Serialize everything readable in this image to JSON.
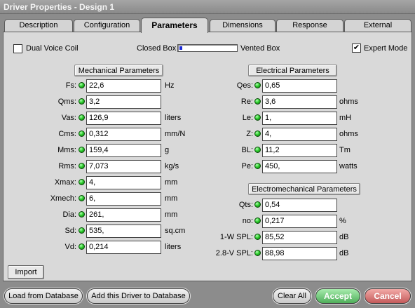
{
  "window": {
    "title": "Driver Properties - Design 1"
  },
  "tabs": [
    "Description",
    "Configuration",
    "Parameters",
    "Dimensions",
    "Response",
    "External"
  ],
  "active_tab": "Parameters",
  "options": {
    "dual_voice_coil_label": "Dual Voice Coil",
    "dual_voice_coil_checked": false,
    "closed_box_label": "Closed Box",
    "vented_box_label": "Vented Box",
    "box_slider_value": 0,
    "expert_mode_label": "Expert Mode",
    "expert_mode_checked": true,
    "check_glyph": "✔"
  },
  "mechanical": {
    "header": "Mechanical Parameters",
    "params": [
      {
        "label": "Fs:",
        "value": "22,6",
        "unit": "Hz"
      },
      {
        "label": "Qms:",
        "value": "3,2",
        "unit": ""
      },
      {
        "label": "Vas:",
        "value": "126,9",
        "unit": "liters"
      },
      {
        "label": "Cms:",
        "value": "0,312",
        "unit": "mm/N"
      },
      {
        "label": "Mms:",
        "value": "159,4",
        "unit": "g"
      },
      {
        "label": "Rms:",
        "value": "7,073",
        "unit": "kg/s"
      },
      {
        "label": "Xmax:",
        "value": "4,",
        "unit": "mm"
      },
      {
        "label": "Xmech:",
        "value": "6,",
        "unit": "mm"
      },
      {
        "label": "Dia:",
        "value": "261,",
        "unit": "mm"
      },
      {
        "label": "Sd:",
        "value": "535,",
        "unit": "sq.cm"
      },
      {
        "label": "Vd:",
        "value": "0,214",
        "unit": "liters"
      }
    ]
  },
  "electrical": {
    "header": "Electrical Parameters",
    "params": [
      {
        "label": "Qes:",
        "value": "0,65",
        "unit": ""
      },
      {
        "label": "Re:",
        "value": "3,6",
        "unit": "ohms"
      },
      {
        "label": "Le:",
        "value": "1,",
        "unit": "mH"
      },
      {
        "label": "Z:",
        "value": "4,",
        "unit": "ohms"
      },
      {
        "label": "BL:",
        "value": "11,2",
        "unit": "Tm"
      },
      {
        "label": "Pe:",
        "value": "450,",
        "unit": "watts"
      }
    ]
  },
  "electromechanical": {
    "header": "Electromechanical Parameters",
    "params": [
      {
        "label": "Qts:",
        "value": "0,54",
        "unit": ""
      },
      {
        "label": "no:",
        "value": "0,217",
        "unit": "%"
      },
      {
        "label": "1-W SPL:",
        "value": "85,52",
        "unit": "dB"
      },
      {
        "label": "2.8-V SPL:",
        "value": "88,98",
        "unit": "dB"
      }
    ]
  },
  "import_label": "Import",
  "footer": {
    "load_label": "Load from Database",
    "add_label": "Add this Driver to Database",
    "clear_label": "Clear All",
    "accept_label": "Accept",
    "cancel_label": "Cancel"
  },
  "colors": {
    "led": "#2ed02e",
    "accept": "#5cba66",
    "cancel": "#d06a6a",
    "slider_thumb": "#1a2ad6"
  }
}
